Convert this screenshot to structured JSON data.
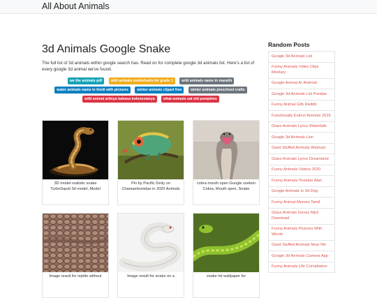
{
  "site": {
    "brand": "All About Animals"
  },
  "article": {
    "title": "3d Animals Google Snake",
    "intro": "The full list of 3d animals within google search has. Read on for complete google 3d animals list. Here's a list of every google 3d animal we've found."
  },
  "tags": [
    {
      "label": "we the animals pdf",
      "color": "#17a2b8"
    },
    {
      "label": "wild animals worksheets for grade 1",
      "color": "#f0ad1e"
    },
    {
      "label": "wild animals name in marathi",
      "color": "#6c757d"
    },
    {
      "label": "water animals name in hindi with pictures",
      "color": "#0d7fc1"
    },
    {
      "label": "winter animals clipart free",
      "color": "#0d7fc1"
    },
    {
      "label": "winter animals preschool crafts",
      "color": "#6c757d"
    },
    {
      "label": "wild animal artinya bahasa indonesianya",
      "color": "#dc3545"
    },
    {
      "label": "what animals eat old pumpkins",
      "color": "#dc3545"
    }
  ],
  "cards": [
    {
      "caption": "3D model realistic snake TurboSquid 3d model, Model",
      "icon": "snake-3d-image"
    },
    {
      "caption": "Pin by Pacific Deity on Chamaeleonidae in 2020 Animals",
      "icon": "chameleon-image"
    },
    {
      "caption": "cobra mouth open Google zoeken Cobra, Mouth open, Snake",
      "icon": "cobra-image"
    },
    {
      "caption": "Image result for reptile without",
      "icon": "reptile-scales-image"
    },
    {
      "caption": "Image result for snake on a",
      "icon": "white-snake-image"
    },
    {
      "caption": "snake hd wallpaper for",
      "icon": "green-snake-image"
    }
  ],
  "sidebar": {
    "title": "Random Posts",
    "items": [
      "Google 3d Animals List",
      "Funny Animals Video Clips Monkey",
      "Google Animal Ar Android",
      "Google 3d Animals List Pandas",
      "Funny Animal Gifs Reddit",
      "Functionally Extinct Animals 2019",
      "Glass Animals Lyrics Waterfalls",
      "Google 3d Animals Lion",
      "Giant Stuffed Animals Walmart",
      "Glass Animals Lyrics Dreamland",
      "Funny Animals Videos 2020",
      "Funny Animals Youtube Alan",
      "Google Animals In 3d Dog",
      "Funny Animal Memes Tamil",
      "Glass Animals Gooey Mp3 Download",
      "Funny Animals Pictures With Words",
      "Giant Stuffed Animals Near Me",
      "Google 3d Animals Camera App",
      "Funny Animals Life Compilation"
    ]
  }
}
